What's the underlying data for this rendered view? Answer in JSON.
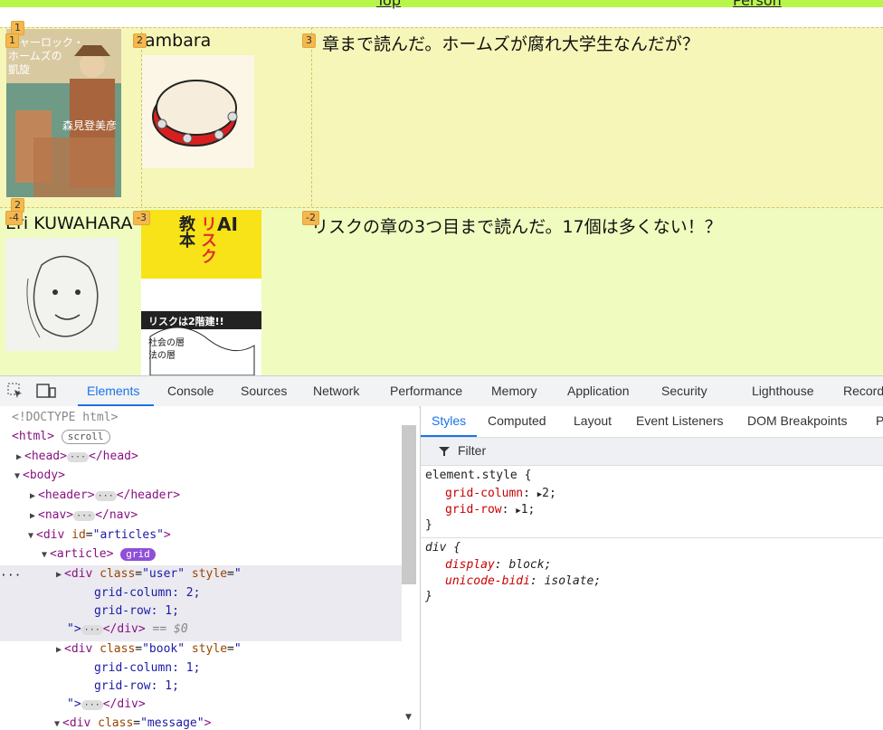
{
  "page": {
    "top_links": [
      "Top",
      "Person"
    ],
    "articles": [
      {
        "user_name": "ambara",
        "message": "章まで読んだ。ホームズが腐れ大学生なんだが？",
        "book_cover_text": [
          "シャーロック・",
          "ホームズの",
          "凱旋",
          "森見登美彦"
        ]
      },
      {
        "user_name": "Eri KUWAHARA",
        "message": "リスクの章の3つ目まで読んだ。17個は多くない！？",
        "book_cover_text": [
          "AI",
          "リスク",
          "教本",
          "リスクは2階建!!",
          "社会の層",
          "法の層"
        ]
      }
    ],
    "grid_badges": {
      "row1": [
        "1",
        "1",
        "2",
        "3"
      ],
      "row2": [
        "2",
        "-4",
        "-3",
        "-2"
      ]
    }
  },
  "devtools": {
    "main_tabs": [
      "Elements",
      "Console",
      "Sources",
      "Network",
      "Performance",
      "Memory",
      "Application",
      "Security",
      "Lighthouse",
      "Record"
    ],
    "active_tab": "Elements",
    "dom": {
      "doctype": "<!DOCTYPE html>",
      "html_open": "<html>",
      "scroll_badge": "scroll",
      "head": "<head>",
      "head_close": "</head>",
      "body": "<body>",
      "header": "<header>",
      "header_close": "</header>",
      "nav": "<nav>",
      "nav_close": "</nav>",
      "div_articles_tag": "<div ",
      "div_articles_attr": "id",
      "div_articles_val": "\"articles\"",
      "article": "<article>",
      "grid_badge": "grid",
      "div_user_tag": "<div ",
      "div_user_class_attr": "class",
      "div_user_class_val": "\"user\"",
      "style_attr": "style",
      "style_open": "\"",
      "gc2": "grid-column: 2;",
      "gr1": "grid-row: 1;",
      "close_q": "\">",
      "div_close": "</div>",
      "eq0": "== $0",
      "div_book_class_val": "\"book\"",
      "gc1": "grid-column: 1;",
      "div_message_class_val": "\"message\""
    },
    "styles_tabs": [
      "Styles",
      "Computed",
      "Layout",
      "Event Listeners",
      "DOM Breakpoints",
      "P"
    ],
    "filter_label": "Filter",
    "rules": {
      "element_style_selector": "element.style {",
      "grid_column_prop": "grid-column",
      "grid_column_val": "2;",
      "grid_row_prop": "grid-row",
      "grid_row_val": "1;",
      "close_brace": "}",
      "div_selector": "div {",
      "display_prop": "display",
      "display_val": "block;",
      "unicode_prop": "unicode-bidi",
      "unicode_val": "isolate;"
    }
  }
}
